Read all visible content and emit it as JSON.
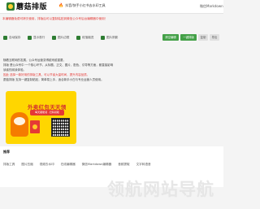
{
  "header": {
    "logo_text": "蘑菇排版",
    "promo_text": "抖音/快手小红书去水印工具",
    "right_link": "微信Markdown"
  },
  "notice": {
    "text": "本编辑器免费可拷贝使用，排版后可以复制粘贴到微信公众号后台编辑器中使用！"
  },
  "toolbar": {
    "items": [
      {
        "label": "自动保存"
      },
      {
        "label": "显示首行"
      },
      {
        "label": "图片边框"
      },
      {
        "label": "段落缩进"
      },
      {
        "label": "图片阴影"
      }
    ],
    "buttons": [
      {
        "label": "清空编辑"
      },
      {
        "label": "一键排版"
      },
      {
        "label": "复制"
      },
      {
        "label": "导出"
      }
    ]
  },
  "article": {
    "lines": [
      "随着互联网的发展，公众号运营变得越来越重要，",
      "排版 是公众号中 一个核心环节，从标题、正文、图片、配色、引导等方面，都直接影响",
      "读者的阅读体验。",
      "因此 选择一款好用的排版工具，可以节省大量时间，提升内容品质。",
      "蘑菇排版 支持一键复制粘贴，简单易上手，适合新手小白与专业运营人员使用。"
    ]
  },
  "promo_card": {
    "title": "外卖红包天天领",
    "subtitle": "每天都能领 · 扫码领取"
  },
  "section": {
    "title": "推荐",
    "links": [
      "排版工具",
      "图片压缩",
      "视频去水印",
      "在线编辑器",
      "微信Markdown编辑器",
      "音频提取",
      "文字转语音"
    ]
  },
  "watermark": {
    "text": "领航网站导航"
  },
  "colors": {
    "accent": "#43a047",
    "notice": "#e53935",
    "promo_bg": "#ffd600"
  }
}
